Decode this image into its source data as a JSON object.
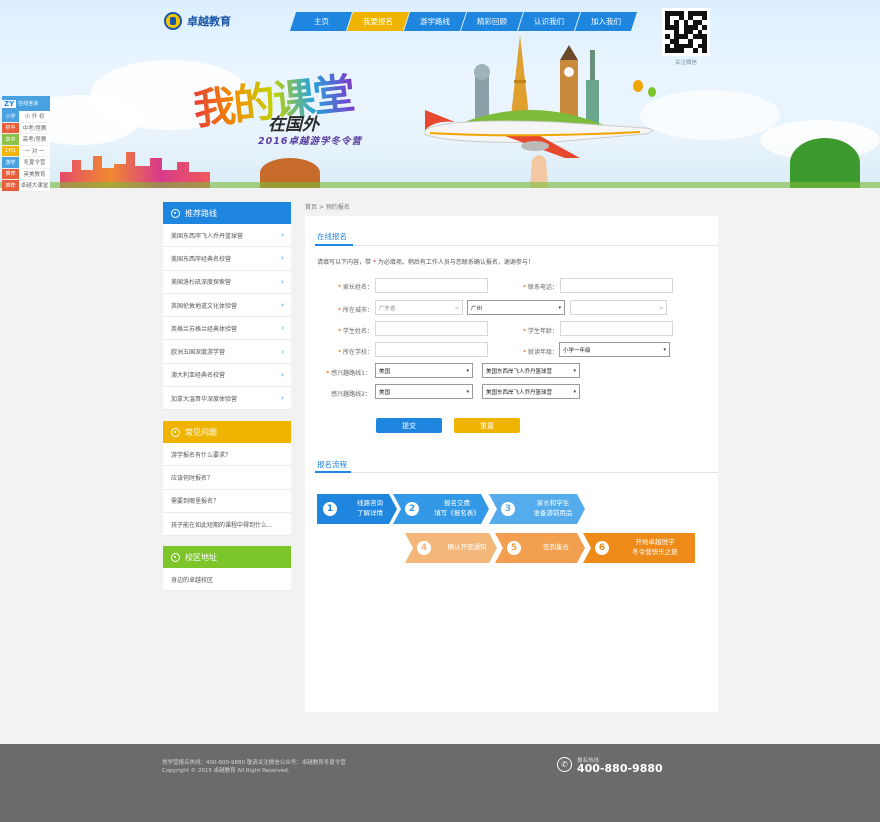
{
  "header": {
    "logo_text": "卓越教育",
    "nav": [
      {
        "label": "主页",
        "active": false
      },
      {
        "label": "我要报名",
        "active": true
      },
      {
        "label": "游学路线",
        "active": false
      },
      {
        "label": "精彩回顾",
        "active": false
      },
      {
        "label": "认识我们",
        "active": false
      },
      {
        "label": "加入我们",
        "active": false
      }
    ],
    "qr_caption": "关注微信",
    "banner": {
      "slogan_main": "我的课堂",
      "slogan_sub": "在国外",
      "slogan_event": "2016卓越游学冬令营"
    }
  },
  "float_bar": {
    "brand": "ZY",
    "head_text": "在线咨询",
    "rows": [
      {
        "tag": "小学",
        "text": "小 升 初",
        "color": "#4aa1e0"
      },
      {
        "tag": "初中",
        "text": "中考/竞赛",
        "color": "#e85d3b"
      },
      {
        "tag": "高中",
        "text": "高考/竞赛",
        "color": "#8bc34a"
      },
      {
        "tag": "1对1",
        "text": "一 对 一",
        "color": "#f0b400"
      },
      {
        "tag": "游学",
        "text": "冬夏令营",
        "color": "#4aa1e0"
      },
      {
        "tag": "推荐",
        "text": "英美教育",
        "color": "#e85d3b"
      },
      {
        "tag": "推荐",
        "text": "卓越大课堂",
        "color": "#e85d3b"
      }
    ]
  },
  "sidebar": {
    "routes": {
      "title": "推荐路线",
      "color": "#1f86e0",
      "items": [
        "美国东西岸飞人乔丹篮球营",
        "美国东西岸经典名校营",
        "美国洛杉矶深度探索营",
        "英国伦敦地道文化体验营",
        "英格兰苏格兰经典体验营",
        "欧洲五国深度游学营",
        "澳大利亚经典名校营",
        "加拿大温哥华深度体验营"
      ]
    },
    "faq": {
      "title": "常见问题",
      "color": "#f0b400",
      "items": [
        "游学报名有什么要求？",
        "应该何时报名？",
        "需要到哪里报名？",
        "孩子能在如此短期的课程中得到什么..."
      ]
    },
    "campus": {
      "title": "校区地址",
      "color": "#7cc52b",
      "items": [
        "身边的卓越校区"
      ]
    }
  },
  "breadcrumb": "首页 > 预约报名",
  "form": {
    "title": "在线报名",
    "notice_prefix": "请填写以下内容，带",
    "notice_star": "*",
    "notice_suffix": "为必填项。稍后有工作人员与您联系确认报名，谢谢参与！",
    "fields": {
      "parent_name": {
        "label": "家长姓名：",
        "value": ""
      },
      "phone": {
        "label": "联系电话：",
        "value": ""
      },
      "city": {
        "label": "所在城市：",
        "province": "广东省",
        "city": "广州",
        "district": ""
      },
      "student_name": {
        "label": "学生姓名：",
        "value": ""
      },
      "student_age": {
        "label": "学生年龄：",
        "value": ""
      },
      "school": {
        "label": "所在学校：",
        "value": ""
      },
      "grade": {
        "label": "就读年级：",
        "value": "小学一年级"
      },
      "route1": {
        "label": "感兴趣路线1：",
        "country": "美国",
        "route": "美国东西岸飞人乔丹篮球营"
      },
      "route2": {
        "label": "感兴趣路线2：",
        "country": "美国",
        "route": "美国东西岸飞人乔丹篮球营"
      }
    },
    "submit_label": "提交",
    "reset_label": "重置"
  },
  "process": {
    "title": "报名流程",
    "steps": [
      {
        "num": "1",
        "lines": [
          "线路咨询",
          "了解详情"
        ],
        "color": "#1f86e0"
      },
      {
        "num": "2",
        "lines": [
          "报名交费",
          "填写《报名表》"
        ],
        "color": "#3399e6"
      },
      {
        "num": "3",
        "lines": [
          "家长和学生",
          "准备游前用品"
        ],
        "color": "#55acec"
      },
      {
        "num": "4",
        "lines": [
          "确认开营通知"
        ],
        "color": "#f3b77a"
      },
      {
        "num": "5",
        "lines": [
          "签到集合"
        ],
        "color": "#f2a04f"
      },
      {
        "num": "6",
        "lines": [
          "开始卓越悦学",
          "冬令营快乐之旅"
        ],
        "color": "#ee8a18"
      }
    ]
  },
  "footer": {
    "line1": "悦学营报名热线：400-800-9880 敬请关注微信公众号：卓越教育冬夏令营",
    "line2": "Copyright © 2015 卓越教育 All Right Reserved.",
    "hotline_label": "报名热线",
    "hotline": "400-880-9880"
  },
  "colors": {
    "primary": "#1f86e0",
    "accent": "#f0b400",
    "green": "#7cc52b",
    "orange": "#ee8a18"
  }
}
